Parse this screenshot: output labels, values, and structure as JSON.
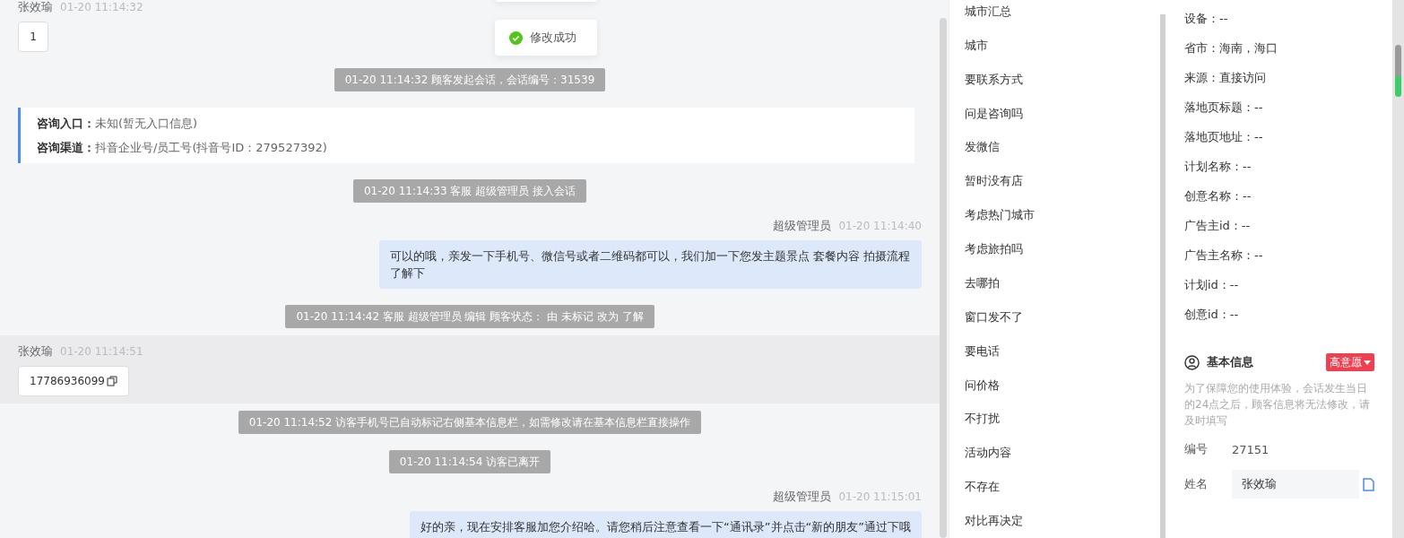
{
  "toast": {
    "text": "修改成功"
  },
  "messages": [
    {
      "kind": "customer",
      "name": "张效瑜",
      "time": "01-20 11:14:32",
      "text": "1",
      "highlighted": false,
      "copyable": false
    },
    {
      "kind": "notice",
      "text": "01-20 11:14:32 顾客发起会话，会话编号：31539"
    },
    {
      "kind": "info",
      "rows": [
        {
          "label": "咨询入口：",
          "value": "未知(暂无入口信息)"
        },
        {
          "label": "咨询渠道：",
          "value": "抖音企业号/员工号(抖音号ID：279527392)"
        }
      ]
    },
    {
      "kind": "notice",
      "text": "01-20 11:14:33 客服 超级管理员 接入会话"
    },
    {
      "kind": "agent",
      "name": "超级管理员",
      "time": "01-20 11:14:40",
      "text": "可以的哦，亲发一下手机号、微信号或者二维码都可以，我们加一下您发主题景点 套餐内容 拍摄流程了解下"
    },
    {
      "kind": "notice",
      "text": "01-20 11:14:42 客服 超级管理员 编辑 顾客状态： 由 未标记 改为 了解"
    },
    {
      "kind": "customer",
      "name": "张效瑜",
      "time": "01-20 11:14:51",
      "text": "17786936099",
      "highlighted": true,
      "copyable": true
    },
    {
      "kind": "notice",
      "text": "01-20 11:14:52 访客手机号已自动标记右侧基本信息栏，如需修改请在基本信息栏直接操作"
    },
    {
      "kind": "notice",
      "text": "01-20 11:14:54 访客已离开"
    },
    {
      "kind": "agent",
      "name": "超级管理员",
      "time": "01-20 11:15:01",
      "text": "好的亲，现在安排客服加您介绍哈。请您稍后注意查看一下“通讯录”并点击“新的朋友”通过下哦"
    }
  ],
  "tags": [
    "城市汇总",
    "城市",
    "要联系方式",
    "问是咨询吗",
    "发微信",
    "暂时没有店",
    "考虑热门城市",
    "考虑旅拍吗",
    "去哪拍",
    "窗口发不了",
    "要电话",
    "问价格",
    "不打扰",
    "活动内容",
    "不存在",
    "对比再决定"
  ],
  "source_info": [
    "设备：--",
    "省市：海南，海口",
    "来源：直接访问",
    "落地页标题：--",
    "落地页地址：--",
    "计划名称：--",
    "创意名称：--",
    "广告主id：--",
    "广告主名称：--",
    "计划id：--",
    "创意id：--"
  ],
  "basic_info": {
    "title": "基本信息",
    "intent": "高意愿",
    "notice": "为了保障您的使用体验，会话发生当日的24点之后，顾客信息将无法修改，请及时填写",
    "id_label": "编号",
    "id_value": "27151",
    "name_label": "姓名",
    "name_value": "张效瑜"
  }
}
